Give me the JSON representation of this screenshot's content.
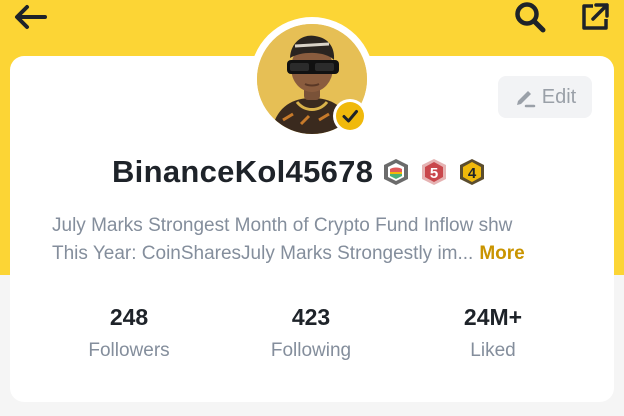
{
  "header": {
    "back_icon": "back-arrow-icon",
    "search_icon": "search-icon",
    "share_icon": "share-icon"
  },
  "profile": {
    "username": "BinanceKol45678",
    "verified": true,
    "badges": [
      {
        "icon": "rainbow-shield-badge-icon"
      },
      {
        "icon": "level-badge-icon",
        "text": "5"
      },
      {
        "icon": "level-badge-icon",
        "text": "4"
      }
    ],
    "edit_label": "Edit",
    "bio_line1": "July Marks Strongest Month of Crypto Fund Inflow shw",
    "bio_line2": "This Year: CoinSharesJuly Marks Strongestly im...",
    "more_label": "More"
  },
  "stats": [
    {
      "value": "248",
      "label": "Followers"
    },
    {
      "value": "423",
      "label": "Following"
    },
    {
      "value": "24M+",
      "label": "Liked"
    }
  ],
  "colors": {
    "brand_yellow": "#fcd535",
    "accent_gold": "#c99400",
    "text_primary": "#1e2329",
    "text_secondary": "#848e9c"
  }
}
